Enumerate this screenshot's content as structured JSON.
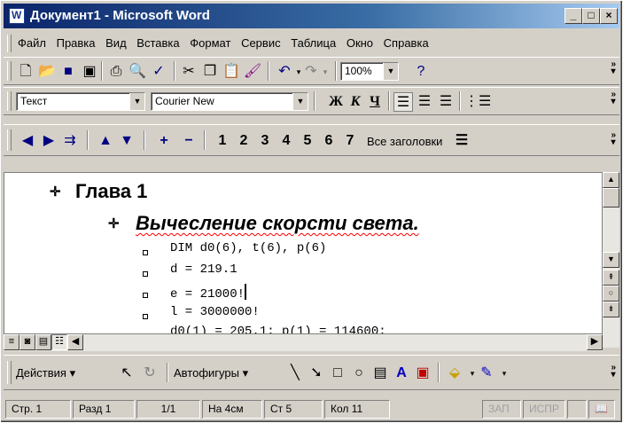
{
  "window": {
    "title": "Документ1 - Microsoft Word"
  },
  "menu": [
    "Файл",
    "Правка",
    "Вид",
    "Вставка",
    "Формат",
    "Сервис",
    "Таблица",
    "Окно",
    "Справка"
  ],
  "standard_toolbar": {
    "zoom": "100%"
  },
  "formatting_toolbar": {
    "style": "Текст",
    "font": "Courier New",
    "bold": "Ж",
    "italic": "К",
    "underline": "Ч"
  },
  "outline_toolbar": {
    "levels": [
      "1",
      "2",
      "3",
      "4",
      "5",
      "6",
      "7"
    ],
    "all_headings": "Все заголовки"
  },
  "document": {
    "heading1": "Глава 1",
    "heading2": "Вычесление скорсти света.",
    "code_lines": [
      "DIM d0(6), t(6), p(6)",
      "d = 219.1",
      "e = 21000!",
      "l = 3000000!",
      "d0(1) = 205.1: p(1) = 114600:"
    ]
  },
  "drawing_toolbar": {
    "actions": "Действия",
    "autoshapes": "Автофигуры"
  },
  "status": {
    "page": "Стр. 1",
    "section": "Разд 1",
    "pages": "1/1",
    "at": "На 4см",
    "line": "Ст 5",
    "col": "Кол 11",
    "rec": "ЗАП",
    "trk": "ИСПР"
  }
}
